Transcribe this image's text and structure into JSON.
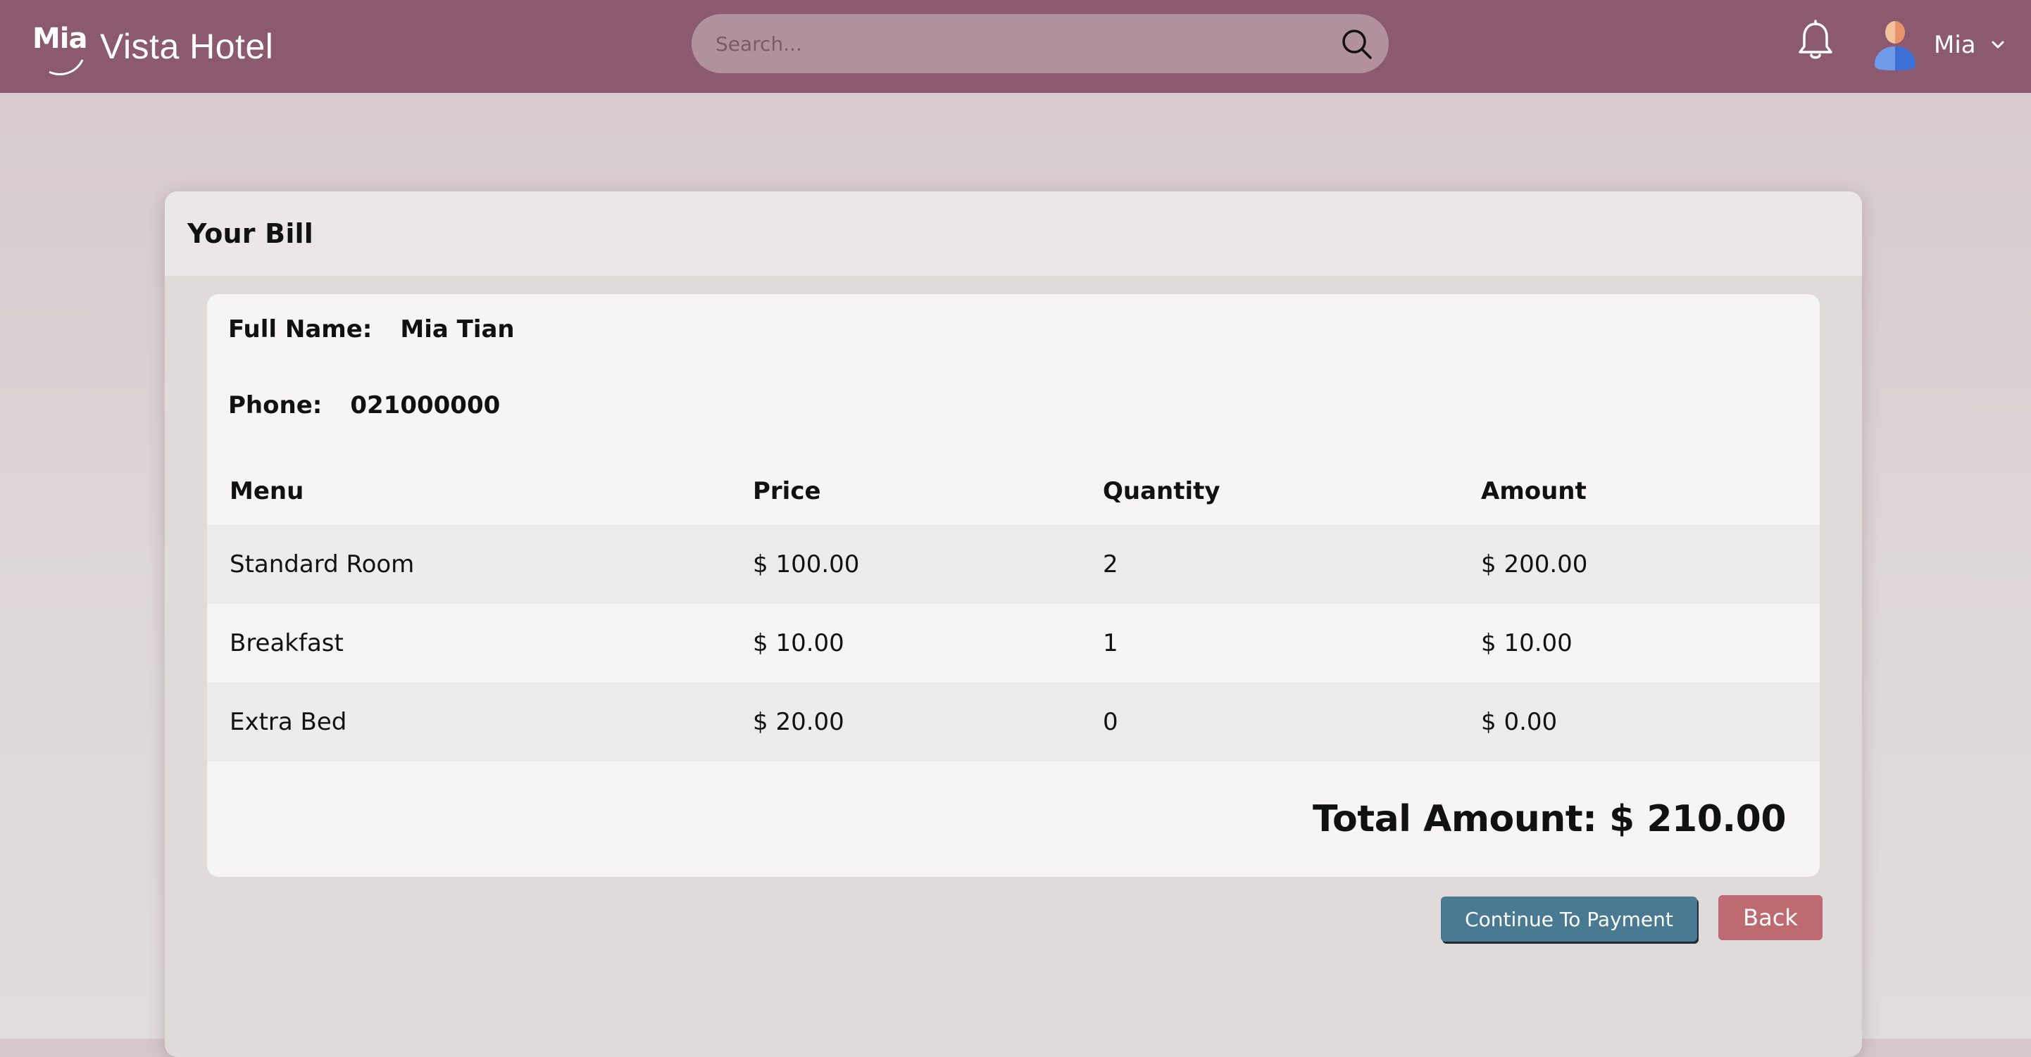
{
  "header": {
    "logo_text": "Mia",
    "app_title": "Vista Hotel",
    "search_placeholder": "Search...",
    "user_name": "Mia",
    "colors": {
      "bar": "#8b5a6e",
      "search_bg": "#b0919d"
    }
  },
  "bill": {
    "title": "Your Bill",
    "full_name_label": "Full Name:",
    "full_name_value": "Mia Tian",
    "phone_label": "Phone:",
    "phone_value": "021000000",
    "columns": [
      "Menu",
      "Price",
      "Quantity",
      "Amount"
    ],
    "rows": [
      {
        "menu": "Standard Room",
        "price": "$ 100.00",
        "quantity": "2",
        "amount": "$ 200.00"
      },
      {
        "menu": "Breakfast",
        "price": "$ 10.00",
        "quantity": "1",
        "amount": "$ 10.00"
      },
      {
        "menu": "Extra Bed",
        "price": "$ 20.00",
        "quantity": "0",
        "amount": "$ 0.00"
      }
    ],
    "total": "Total Amount: $ 210.00"
  },
  "actions": {
    "continue_label": "Continue To Payment",
    "back_label": "Back",
    "colors": {
      "continue": "#4a7a92",
      "back": "#bd6a70"
    }
  },
  "icons": [
    "search-icon",
    "bell-icon",
    "avatar",
    "chevron-down-icon",
    "logo"
  ]
}
